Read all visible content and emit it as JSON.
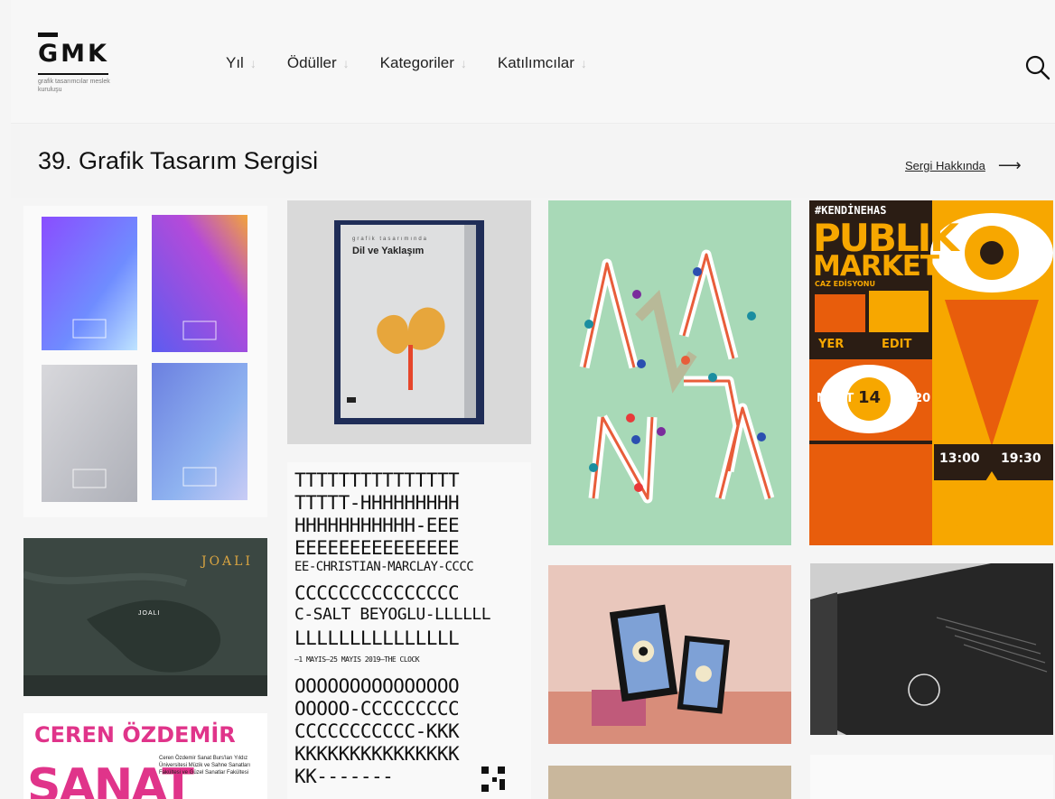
{
  "header": {
    "logo_text": "GMK",
    "logo_subtitle": "grafik tasarımcılar meslek kuruluşu",
    "nav": [
      {
        "label": "Yıl"
      },
      {
        "label": "Ödüller"
      },
      {
        "label": "Kategoriler"
      },
      {
        "label": "Katılımcılar"
      }
    ],
    "search_icon": "search-icon"
  },
  "page": {
    "title": "39. Grafik Tasarım Sergisi",
    "about_link": "Sergi Hakkında",
    "about_arrow": "⟶"
  },
  "cards": {
    "book_cover": {
      "kicker": "grafik tasarımında",
      "title": "Dil ve Yaklaşım"
    },
    "publik": {
      "hashtag": "#KENDİNEHAS",
      "publik": "PUBLIK",
      "market": "MARKET",
      "edition": "CAZ EDİSYONU",
      "yer": "YER",
      "edit": "EDIT",
      "mart": "MART",
      "day": "14",
      "year": "2020",
      "time_start": "13:00",
      "time_end": "19:30"
    },
    "joali": {
      "title": "JOALI",
      "center_label": "JOALI"
    },
    "ceren": {
      "name": "CEREN ÖZDEMİR",
      "big": "SANAT",
      "info": "Ceren Özdemir Sanat Burs'ları Yıldız Üniversitesi Müzik ve Sahne Sanatları Fakültesi ve Güzel Sanatlar Fakültesi"
    },
    "letters": {
      "rows": [
        "TTTTTTTTTTTTTTT",
        "TTTTT-HHHHHHHHH",
        "HHHHHHHHHHH-EEE",
        "EEEEEEEEEEEEEEE",
        "EE-CHRISTIAN-MARCLAY-CCCC",
        "CCCCCCCCCCCCCCC",
        "C-SALT BEYOGLU-LLLLLL",
        "LLLLLLLLLLLLLLL",
        "—1 MAYIS—25 MAYIS 2019—THE CLOCK",
        "OOOOOOOOOOOOOOO",
        "OOOOO-CCCCCCCCC",
        "CCCCCCCCCCC-KKK",
        "KKKKKKKKKKKKKKK",
        "KK-------"
      ]
    },
    "adana": {
      "text": "ADANA"
    }
  },
  "colors": {
    "background": "#f5f5f5",
    "adana_bg": "#a8d9b7",
    "publik_orange": "#f7a700",
    "publik_red": "#e85d0c",
    "ceren_pink": "#e0348a"
  }
}
